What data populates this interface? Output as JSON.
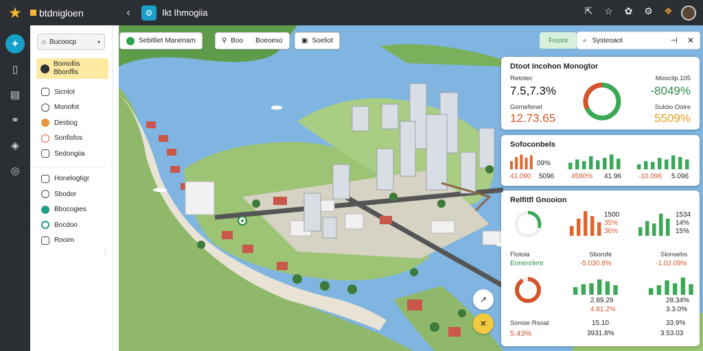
{
  "app": {
    "brand": "btdnigloen",
    "title": "Ikt Ihmogiia"
  },
  "topbar": {
    "icons": [
      "share-icon",
      "star-icon",
      "palette-icon",
      "settings-icon",
      "apps-icon"
    ]
  },
  "rail": {
    "icons": [
      "compass-icon",
      "document-icon",
      "chart-icon",
      "link-icon",
      "puzzle-icon",
      "globe-icon"
    ]
  },
  "sidebar": {
    "dropdown": "Bucoocp",
    "selected": {
      "line1": "Bomofiis",
      "line2": "Bbonffis"
    },
    "items": [
      {
        "label": "Sicnlot"
      },
      {
        "label": "Monofot"
      },
      {
        "label": "Destiog"
      },
      {
        "label": "Sonfisfos"
      },
      {
        "label": "Sedongiia"
      },
      {
        "label": "Honelogtigr"
      },
      {
        "label": "Sbodor"
      },
      {
        "label": "Bbocogies"
      },
      {
        "label": "Bocdoo"
      },
      {
        "label": "Rooim"
      }
    ]
  },
  "map_toolbar": {
    "primary": "Sebitliet Manenam",
    "btn2_value": "Boo",
    "btn2_label": "Boeoeso",
    "btn3": "Soeliot",
    "pill": "Frocint",
    "search": "Systeoaot"
  },
  "panel1": {
    "title": "Dtoot Incohon Monogtor",
    "left_label": "Retotec",
    "left_value": "7.5,7.3%",
    "left_label2": "Gomefonet",
    "left_value2": "12.73.65",
    "right_label": "Moocilp.105",
    "right_value": "-8049%",
    "right_label2": "Suloio Ooire",
    "right_value2": "5509%",
    "ring": {
      "green": 0.68,
      "orange": 0.32
    }
  },
  "panel2": {
    "title": "Sofoconbels",
    "pct": "09%",
    "a1": "41.090",
    "a2": "5096",
    "b1": "4580%",
    "b2": "41.96",
    "c1": "-10.096",
    "c2": "5.096",
    "bars_o": [
      0.5,
      0.75,
      0.9,
      0.7,
      0.85
    ],
    "bars_g1": [
      0.4,
      0.6,
      0.5,
      0.8,
      0.55,
      0.7,
      0.9,
      0.65
    ],
    "bars_g2": [
      0.3,
      0.5,
      0.45,
      0.7,
      0.6,
      0.85,
      0.75,
      0.6
    ]
  },
  "panel3": {
    "title": "Relfitfl Gnooion",
    "r1a": "1500",
    "r1b": "35%",
    "r1c": "36%",
    "r2a": "1534",
    "r2b": "14%",
    "r2c": "15%",
    "l1": "Flotola",
    "l2": "Eonenrlenr",
    "mid_label": "Sborofe",
    "mid_value": "-5.030.8%",
    "right_label": "Slonsebs",
    "right_value": "-1.02.09%",
    "d1": "2.89.29",
    "d2": "28.34%",
    "d3": "4.81.2%",
    "d4": "3.3.0%",
    "foot_label": "Sonise Rsoat",
    "foot_value": "5.43%",
    "f1": "15.10",
    "f2": "3931.8%",
    "f3": "33.9%",
    "f4": "3.53.03",
    "ring_green": 0.3,
    "ring_orange": 0.92,
    "bars3_o": [
      0.4,
      0.7,
      1.0,
      0.8,
      0.55
    ],
    "bars3_g": [
      0.35,
      0.6,
      0.5,
      0.9,
      0.7
    ],
    "bars4_g1": [
      0.4,
      0.55,
      0.6,
      0.8,
      0.7,
      0.5
    ],
    "bars4_g2": [
      0.35,
      0.5,
      0.75,
      0.6,
      0.9,
      0.55
    ]
  }
}
